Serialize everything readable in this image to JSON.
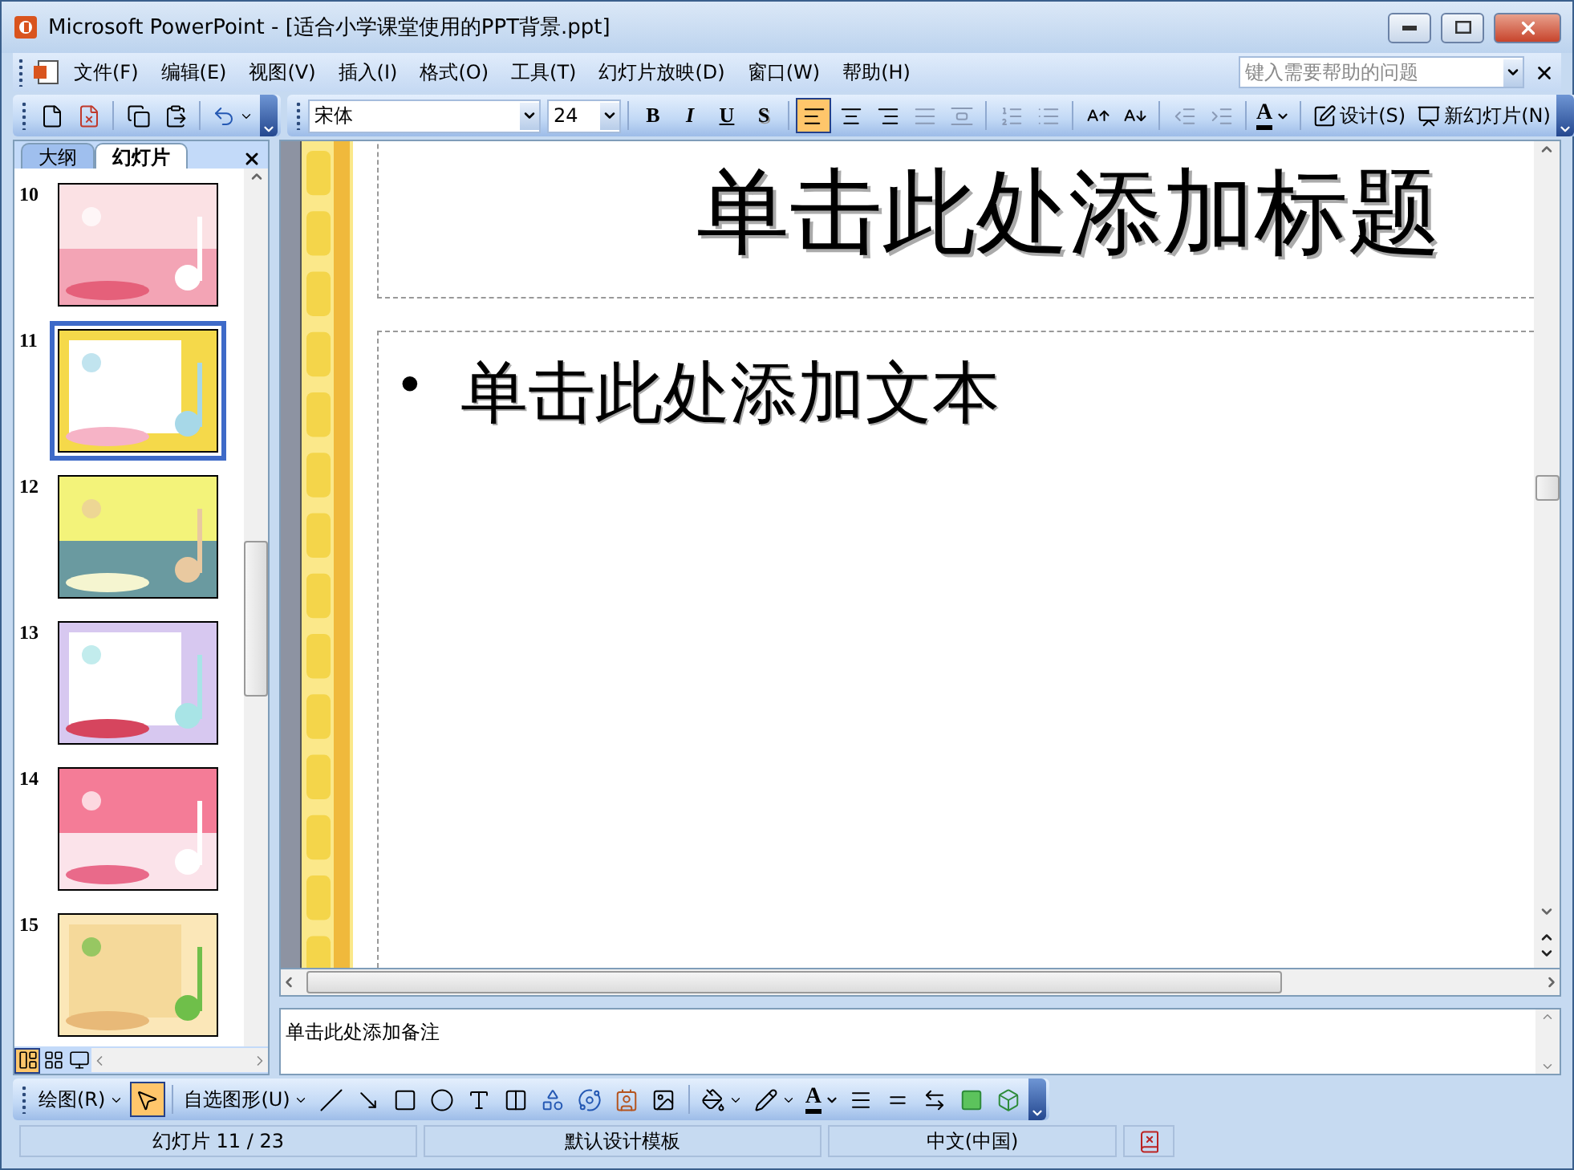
{
  "window": {
    "title": "Microsoft PowerPoint - [适合小学课堂使用的PPT背景.ppt]"
  },
  "menu": [
    {
      "label": "文件(F)"
    },
    {
      "label": "编辑(E)"
    },
    {
      "label": "视图(V)"
    },
    {
      "label": "插入(I)"
    },
    {
      "label": "格式(O)"
    },
    {
      "label": "工具(T)"
    },
    {
      "label": "幻灯片放映(D)"
    },
    {
      "label": "窗口(W)"
    },
    {
      "label": "帮助(H)"
    }
  ],
  "help_search": {
    "placeholder": "键入需要帮助的问题"
  },
  "formatting": {
    "font": "宋体",
    "size": "24",
    "style_buttons": [
      {
        "label": "B",
        "kind": "bold"
      },
      {
        "label": "I",
        "kind": "italic"
      },
      {
        "label": "U",
        "kind": "underline"
      },
      {
        "label": "S",
        "kind": "shadow"
      }
    ],
    "align_buttons": [
      {
        "kind": "left",
        "selected": true
      },
      {
        "kind": "center",
        "selected": false
      },
      {
        "kind": "right",
        "selected": false
      }
    ],
    "font_color": "A",
    "design": "设计(S)",
    "new_slide": "新幻灯片(N)"
  },
  "panel": {
    "tabs": [
      {
        "label": "大纲",
        "selected": false
      },
      {
        "label": "幻灯片",
        "selected": true
      }
    ]
  },
  "slides": [
    {
      "number": "10",
      "selected": false
    },
    {
      "number": "11",
      "selected": true
    },
    {
      "number": "12",
      "selected": false
    },
    {
      "number": "13",
      "selected": false
    },
    {
      "number": "14",
      "selected": false
    },
    {
      "number": "15",
      "selected": false
    }
  ],
  "view_buttons": [
    {
      "kind": "normal",
      "selected": true
    },
    {
      "kind": "sorter",
      "selected": false
    },
    {
      "kind": "show",
      "selected": false
    }
  ],
  "slide": {
    "title": "单击此处添加标题",
    "bullet": "•",
    "body": "单击此处添加文本"
  },
  "notes": "单击此处添加备注",
  "drawing": {
    "draw_menu": "绘图(R)",
    "select_selected": true,
    "autoshapes": "自选图形(U)",
    "font_color": "A"
  },
  "status_bar": [
    "幻灯片 11 / 23",
    "默认设计模板",
    "中文(中国)"
  ]
}
